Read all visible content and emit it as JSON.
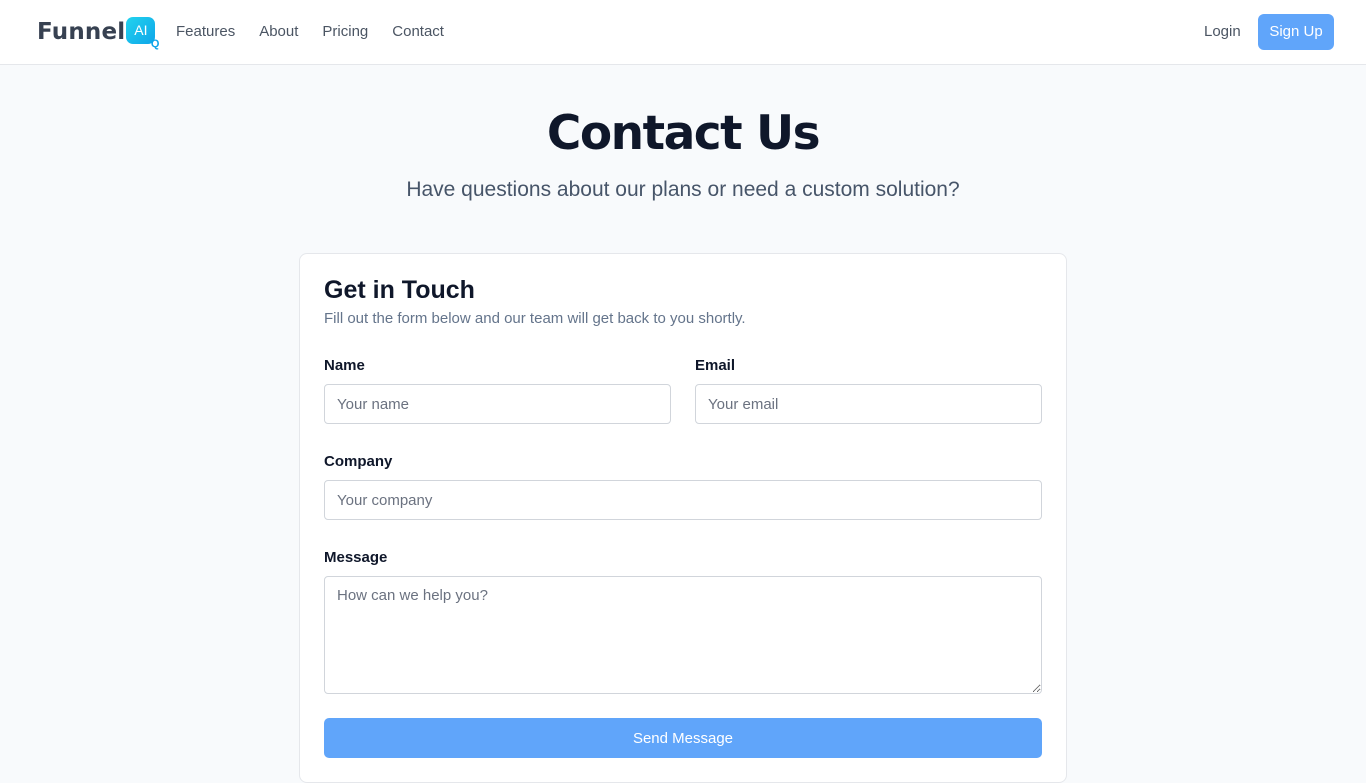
{
  "navbar": {
    "logo_text": "Funnel",
    "logo_badge": "AI",
    "logo_badge_mark": "Q",
    "links": [
      "Features",
      "About",
      "Pricing",
      "Contact"
    ],
    "login_label": "Login",
    "signup_label": "Sign Up"
  },
  "hero": {
    "title": "Contact Us",
    "subtitle": "Have questions about our plans or need a custom solution?"
  },
  "form": {
    "title": "Get in Touch",
    "description": "Fill out the form below and our team will get back to you shortly.",
    "name": {
      "label": "Name",
      "placeholder": "Your name",
      "value": ""
    },
    "email": {
      "label": "Email",
      "placeholder": "Your email",
      "value": ""
    },
    "company": {
      "label": "Company",
      "placeholder": "Your company",
      "value": ""
    },
    "message": {
      "label": "Message",
      "placeholder": "How can we help you?",
      "value": ""
    },
    "submit_label": "Send Message"
  },
  "colors": {
    "accent": "#60a5fa",
    "logo_gradient": [
      "#22d3ee",
      "#0ea5e9"
    ],
    "page_background": "#f8fafc"
  }
}
